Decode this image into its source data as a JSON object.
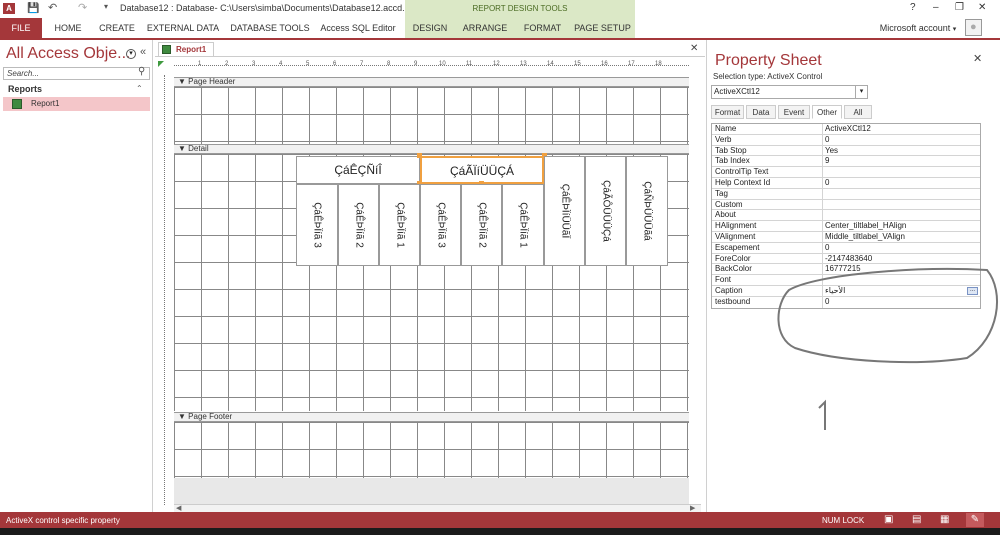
{
  "titlebar": {
    "doc_title": "Database12 : Database- C:\\Users\\simba\\Documents\\Database12.accd...",
    "context_group": "REPORT DESIGN TOOLS",
    "help": "?",
    "minimize": "–",
    "restore": "❐",
    "close": "✕"
  },
  "ribbon": {
    "tabs": [
      "FILE",
      "HOME",
      "CREATE",
      "EXTERNAL DATA",
      "DATABASE TOOLS",
      "Access SQL Editor"
    ],
    "context_tabs": [
      "DESIGN",
      "ARRANGE",
      "FORMAT",
      "PAGE SETUP"
    ],
    "account": "Microsoft account"
  },
  "nav": {
    "title": "All Access Obje...",
    "search_placeholder": "Search...",
    "section": "Reports",
    "items": [
      {
        "label": "Report1"
      }
    ]
  },
  "document": {
    "tab_label": "Report1",
    "sections": {
      "page_header": "Page Header",
      "detail": "Detail",
      "page_footer": "Page Footer"
    },
    "ruler_ticks": [
      "1",
      "2",
      "3",
      "4",
      "5",
      "6",
      "7",
      "8",
      "9",
      "10",
      "11",
      "12",
      "13",
      "14",
      "15",
      "16",
      "17",
      "18"
    ],
    "header_labels": [
      "ÇáÊÇÑíÎ",
      "ÇáÃÏíÜÜÇÁ"
    ],
    "vertical_labels": [
      "ÇáÊÞÏíã 3",
      "ÇáÊÞÏíã 2",
      "ÇáÊÞÏíã 1",
      "ÇáÊÞÏíã 3",
      "ÇáÊÞÏíã 2",
      "ÇáÊÞÏíã 1",
      "ÇáÊÞÏíÜÜãÏ",
      "ÇáÃÔÜÜÜÇá",
      "ÇáÑÞÜÜÜãá"
    ]
  },
  "property_sheet": {
    "title": "Property Sheet",
    "selection_type": "Selection type:  ActiveX Control",
    "selected_control": "ActiveXCtl12",
    "tabs": [
      "Format",
      "Data",
      "Event",
      "Other",
      "All"
    ],
    "active_tab": "Other",
    "close": "✕",
    "rows": [
      {
        "name": "Name",
        "value": "ActiveXCtl12"
      },
      {
        "name": "Verb",
        "value": "0"
      },
      {
        "name": "Tab Stop",
        "value": "Yes"
      },
      {
        "name": "Tab Index",
        "value": "9"
      },
      {
        "name": "ControlTip Text",
        "value": ""
      },
      {
        "name": "Help Context Id",
        "value": "0"
      },
      {
        "name": "Tag",
        "value": ""
      },
      {
        "name": "Custom",
        "value": ""
      },
      {
        "name": "About",
        "value": ""
      },
      {
        "name": "HAlignment",
        "value": "Center_tiltlabel_HAlign"
      },
      {
        "name": "VAlignment",
        "value": "Middle_tiltlabel_VAlign"
      },
      {
        "name": "Escapement",
        "value": "0"
      },
      {
        "name": "ForeColor",
        "value": "-2147483640"
      },
      {
        "name": "BackColor",
        "value": "16777215"
      },
      {
        "name": "Font",
        "value": ""
      },
      {
        "name": "Caption",
        "value": "الأحياء"
      },
      {
        "name": "testbound",
        "value": "0"
      }
    ],
    "builder_button": "..."
  },
  "status": {
    "text": "ActiveX control specific property",
    "numlock": "NUM LOCK"
  },
  "colors": {
    "accent": "#a4373a",
    "context": "#dbe8c6",
    "selection": "#f0a040"
  }
}
